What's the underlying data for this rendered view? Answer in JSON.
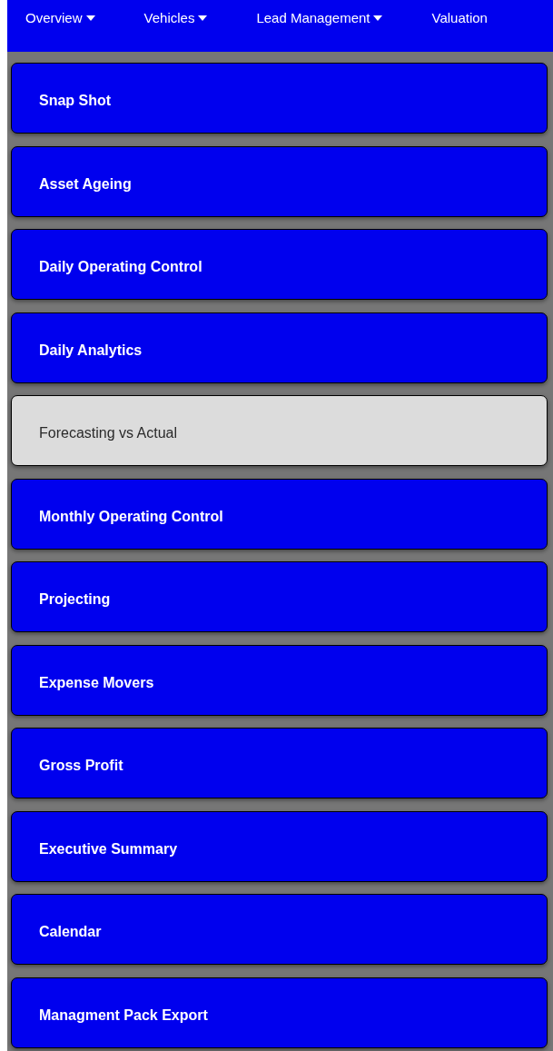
{
  "nav": [
    {
      "label": "Overview",
      "dropdown": true
    },
    {
      "label": "Vehicles",
      "dropdown": true
    },
    {
      "label": "Lead Management",
      "dropdown": true
    },
    {
      "label": "Valuation",
      "dropdown": false
    }
  ],
  "menu": [
    {
      "label": "Snap Shot",
      "selected": false
    },
    {
      "label": "Asset Ageing",
      "selected": false
    },
    {
      "label": "Daily Operating Control",
      "selected": false
    },
    {
      "label": "Daily Analytics",
      "selected": false
    },
    {
      "label": "Forecasting vs Actual",
      "selected": true
    },
    {
      "label": "Monthly Operating Control",
      "selected": false
    },
    {
      "label": "Projecting",
      "selected": false
    },
    {
      "label": "Expense Movers",
      "selected": false
    },
    {
      "label": "Gross Profit",
      "selected": false
    },
    {
      "label": "Executive Summary",
      "selected": false
    },
    {
      "label": "Calendar",
      "selected": false
    },
    {
      "label": "Managment Pack Export",
      "selected": false
    }
  ]
}
